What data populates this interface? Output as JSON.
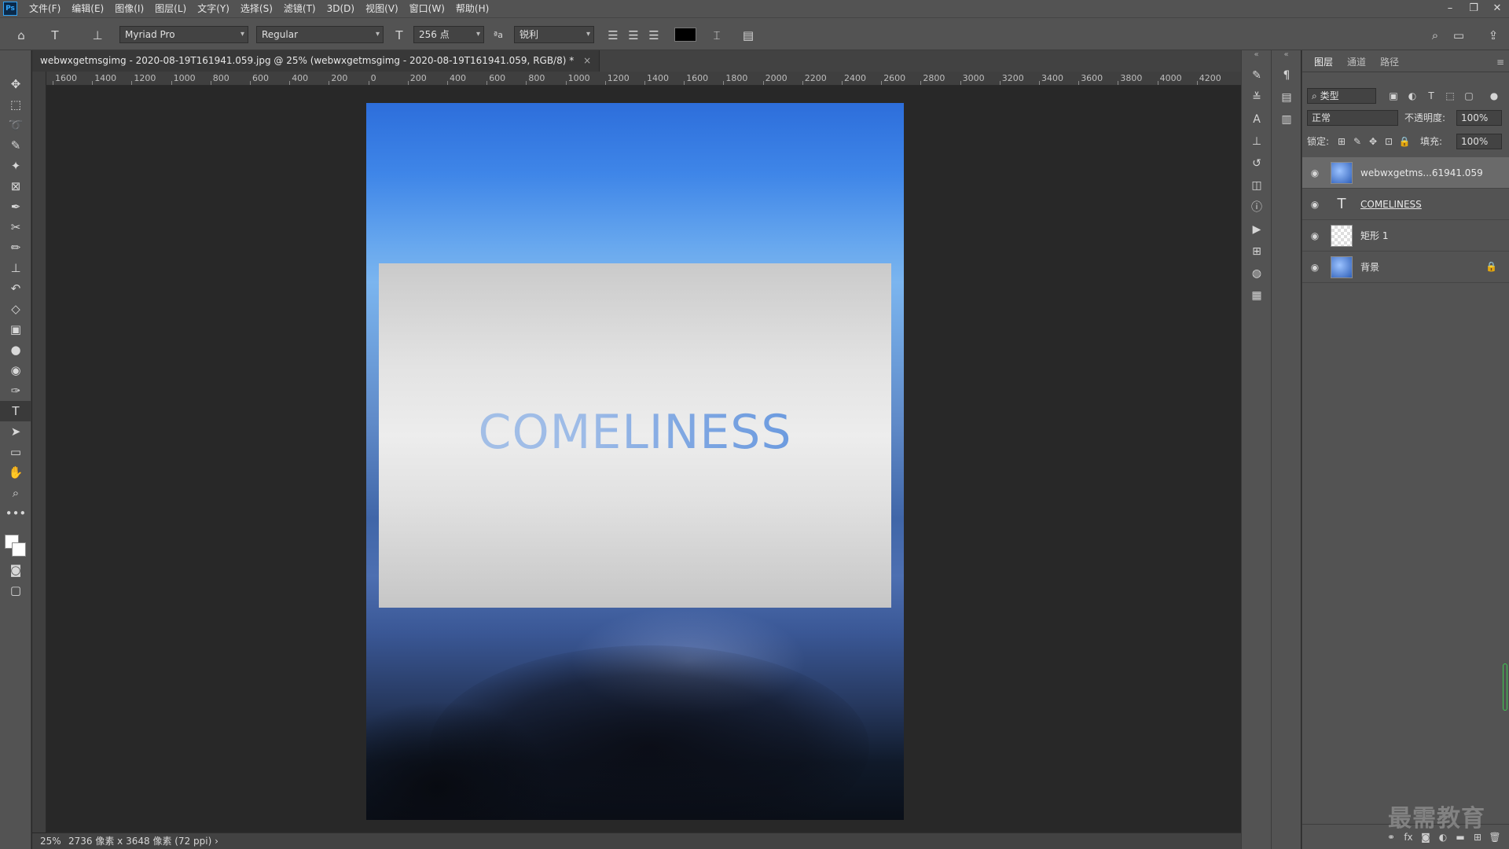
{
  "app": {
    "logo": "Ps"
  },
  "menu": [
    "文件(F)",
    "编辑(E)",
    "图像(I)",
    "图层(L)",
    "文字(Y)",
    "选择(S)",
    "滤镜(T)",
    "3D(D)",
    "视图(V)",
    "窗口(W)",
    "帮助(H)"
  ],
  "window_controls": {
    "minimize": "–",
    "restore": "❐",
    "close": "✕"
  },
  "options": {
    "font_family": "Myriad Pro",
    "font_style": "Regular",
    "font_size": "256 点",
    "aa_label": "ªa",
    "antialias": "锐利"
  },
  "document": {
    "tab_title": "webwxgetmsgimg - 2020-08-19T161941.059.jpg @ 25% (webwxgetmsgimg - 2020-08-19T161941.059, RGB/8) *",
    "close": "×",
    "text_layer_content": "COMELINESS"
  },
  "ruler_top": [
    "1600",
    "1400",
    "1200",
    "1000",
    "800",
    "600",
    "400",
    "200",
    "0",
    "200",
    "400",
    "600",
    "800",
    "1000",
    "1200",
    "1400",
    "1600",
    "1800",
    "2000",
    "2200",
    "2400",
    "2600",
    "2800",
    "3000",
    "3200",
    "3400",
    "3600",
    "3800",
    "4000",
    "4200"
  ],
  "status": {
    "zoom": "25%",
    "doc_info": "2736 像素 x 3648 像素 (72 ppi)",
    "arrow": "›"
  },
  "layers_panel": {
    "tabs": [
      "图层",
      "通道",
      "路径"
    ],
    "filter_label": "类型",
    "blend_mode": "正常",
    "opacity_label": "不透明度:",
    "opacity": "100%",
    "lock_label": "锁定:",
    "fill_label": "填充:",
    "fill": "100%",
    "layers": [
      {
        "name": "webwxgetms...61941.059",
        "type": "image",
        "selected": true
      },
      {
        "name": "COMELINESS",
        "type": "text",
        "selected": false
      },
      {
        "name": "矩形 1",
        "type": "shape",
        "selected": false
      },
      {
        "name": "背景",
        "type": "background",
        "selected": false,
        "locked": true
      }
    ]
  },
  "watermark": "最需教育",
  "colors": {
    "accent": "#31a8ff",
    "panel": "#535353",
    "canvas": "#282828"
  }
}
